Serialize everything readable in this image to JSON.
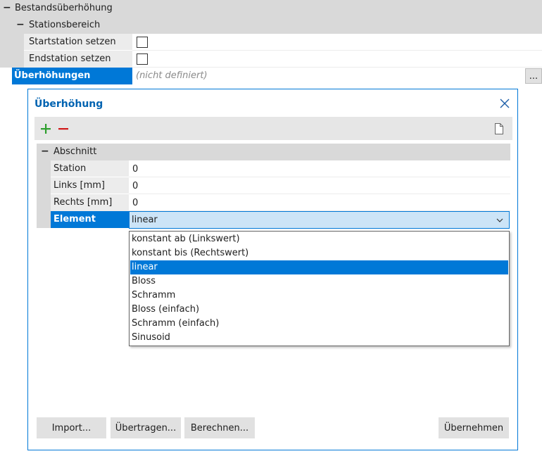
{
  "property_grid": {
    "group_label": "Bestandsüberhöhung",
    "subgroup_label": "Stationsbereich",
    "rows": [
      {
        "label": "Startstation setzen"
      },
      {
        "label": "Endstation setzen"
      }
    ],
    "selected_row_label": "Überhöhungen",
    "selected_row_value": "(nicht definiert)",
    "ellipsis_label": "..."
  },
  "dialog": {
    "title": "Überhöhung",
    "section_label": "Abschnitt",
    "fields": [
      {
        "label": "Station",
        "value": "0"
      },
      {
        "label": "Links [mm]",
        "value": "0"
      },
      {
        "label": "Rechts [mm]",
        "value": "0"
      }
    ],
    "element_label": "Element",
    "element_value": "linear",
    "dropdown_options": [
      "konstant ab (Linkswert)",
      "konstant bis (Rechtswert)",
      "linear",
      "Bloss",
      "Schramm",
      "Bloss (einfach)",
      "Schramm (einfach)",
      "Sinusoid"
    ],
    "selected_option": "linear",
    "buttons": {
      "import": "Import...",
      "transfer": "Übertragen...",
      "calculate": "Berechnen...",
      "apply": "Übernehmen"
    }
  },
  "colors": {
    "accent": "#0078d7",
    "selection": "#0078d7",
    "group_header": "#d9d9d9",
    "add_icon": "#2e9f2e",
    "remove_icon": "#d11a1a"
  }
}
